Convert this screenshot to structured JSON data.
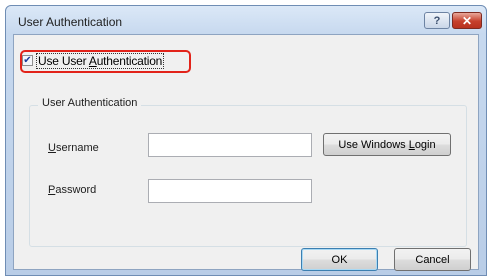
{
  "window": {
    "title": "User Authentication",
    "help_label": "?",
    "close_label": "✕"
  },
  "use_auth": {
    "label_pre": "Use User ",
    "label_accel": "A",
    "label_post": "uthentication",
    "checked": true,
    "check_glyph": "✔"
  },
  "group": {
    "title": "User Authentication",
    "username": {
      "label_accel": "U",
      "label_rest": "sername",
      "value": ""
    },
    "password": {
      "label_accel": "P",
      "label_rest": "assword",
      "value": ""
    },
    "windows_login": {
      "label_pre": "Use Windows ",
      "label_accel": "L",
      "label_post": "ogin"
    }
  },
  "buttons": {
    "ok": "OK",
    "cancel": "Cancel"
  },
  "colors": {
    "highlight_border": "#e2231a",
    "close_button": "#c6402c",
    "title_bar": "#c7d9ef",
    "dialog_body": "#f0f0f0"
  },
  "icons": {
    "help": "question-mark-icon",
    "close": "close-icon",
    "check": "checkmark-icon"
  }
}
